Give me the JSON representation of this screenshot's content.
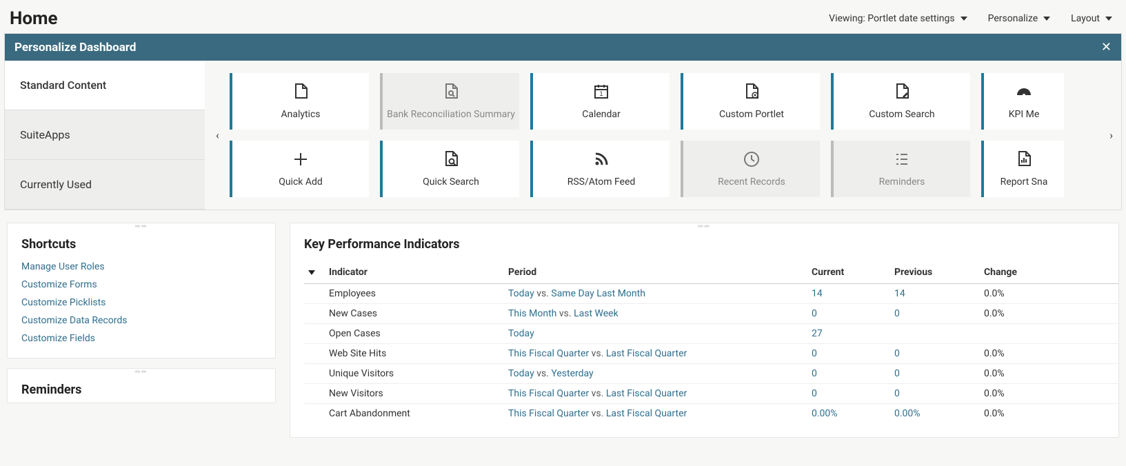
{
  "header": {
    "title": "Home",
    "viewing": "Viewing: Portlet date settings",
    "personalize": "Personalize",
    "layout": "Layout"
  },
  "panel": {
    "title": "Personalize Dashboard",
    "tabs": [
      "Standard Content",
      "SuiteApps",
      "Currently Used"
    ],
    "tiles_row1": [
      {
        "label": "Analytics",
        "icon": "file-icon",
        "disabled": false
      },
      {
        "label": "Bank Reconciliation Summary",
        "icon": "file-search-icon",
        "disabled": true
      },
      {
        "label": "Calendar",
        "icon": "calendar-icon",
        "disabled": false
      },
      {
        "label": "Custom Portlet",
        "icon": "file-gear-icon",
        "disabled": false
      },
      {
        "label": "Custom Search",
        "icon": "file-edit-icon",
        "disabled": false
      },
      {
        "label": "KPI Me",
        "icon": "gauge-icon",
        "disabled": false
      }
    ],
    "tiles_row2": [
      {
        "label": "Quick Add",
        "icon": "plus-icon",
        "disabled": false
      },
      {
        "label": "Quick Search",
        "icon": "file-magnify-icon",
        "disabled": false
      },
      {
        "label": "RSS/Atom Feed",
        "icon": "rss-icon",
        "disabled": false
      },
      {
        "label": "Recent Records",
        "icon": "clock-icon",
        "disabled": true
      },
      {
        "label": "Reminders",
        "icon": "checklist-icon",
        "disabled": true
      },
      {
        "label": "Report Sna",
        "icon": "report-icon",
        "disabled": false
      }
    ]
  },
  "shortcuts": {
    "title": "Shortcuts",
    "items": [
      "Manage User Roles",
      "Customize Forms",
      "Customize Picklists",
      "Customize Data Records",
      "Customize Fields"
    ]
  },
  "reminders": {
    "title": "Reminders"
  },
  "kpi": {
    "title": "Key Performance Indicators",
    "headers": {
      "indicator": "Indicator",
      "period": "Period",
      "current": "Current",
      "previous": "Previous",
      "change": "Change"
    },
    "rows": [
      {
        "indicator": "Employees",
        "p1": "Today",
        "p2": "Same Day Last Month",
        "current": "14",
        "previous": "14",
        "change": "0.0%"
      },
      {
        "indicator": "New Cases",
        "p1": "This Month",
        "p2": "Last Week",
        "current": "0",
        "previous": "0",
        "change": "0.0%"
      },
      {
        "indicator": "Open Cases",
        "p1": "Today",
        "p2": "",
        "current": "27",
        "previous": "",
        "change": ""
      },
      {
        "indicator": "Web Site Hits",
        "p1": "This Fiscal Quarter",
        "p2": "Last Fiscal Quarter",
        "current": "0",
        "previous": "0",
        "change": "0.0%"
      },
      {
        "indicator": "Unique Visitors",
        "p1": "Today",
        "p2": "Yesterday",
        "current": "0",
        "previous": "0",
        "change": "0.0%"
      },
      {
        "indicator": "New Visitors",
        "p1": "This Fiscal Quarter",
        "p2": "Last Fiscal Quarter",
        "current": "0",
        "previous": "0",
        "change": "0.0%"
      },
      {
        "indicator": "Cart Abandonment",
        "p1": "This Fiscal Quarter",
        "p2": "Last Fiscal Quarter",
        "current": "0.00%",
        "previous": "0.00%",
        "change": "0.0%"
      }
    ]
  }
}
